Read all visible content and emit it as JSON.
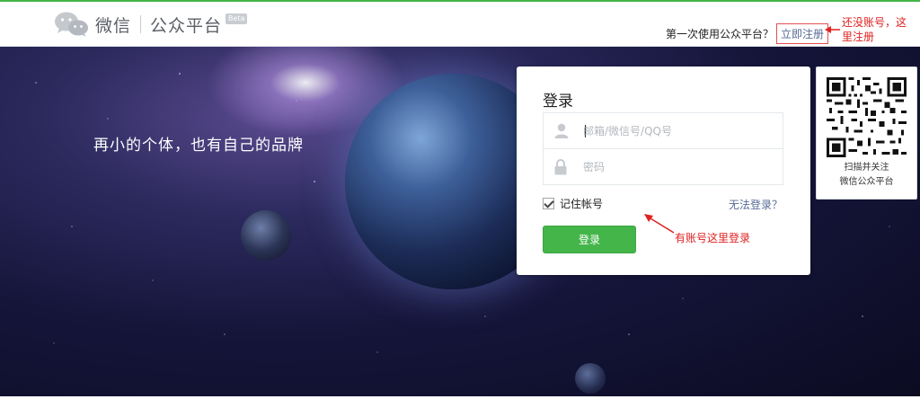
{
  "header": {
    "logo_text": "微信",
    "logo_sub": "公众平台",
    "beta_badge": "Beta",
    "signup_question": "第一次使用公众平台？",
    "signup_link": "立即注册"
  },
  "annotations": {
    "signup_note": "还没账号，这里注册",
    "login_note": "有账号这里登录",
    "color": "#e02020"
  },
  "hero": {
    "slogan": "再小的个体，也有自己的品牌"
  },
  "login": {
    "title": "登录",
    "username_placeholder": "邮箱/微信号/QQ号",
    "password_placeholder": "密码",
    "remember_label": "记住帐号",
    "remember_checked": true,
    "forgot_link": "无法登录？",
    "submit_label": "登录"
  },
  "qr": {
    "caption_line1": "扫描并关注",
    "caption_line2": "微信公众平台"
  },
  "colors": {
    "brand_green": "#44b549",
    "link_blue": "#576b95",
    "hero_dark": "#15153a"
  }
}
